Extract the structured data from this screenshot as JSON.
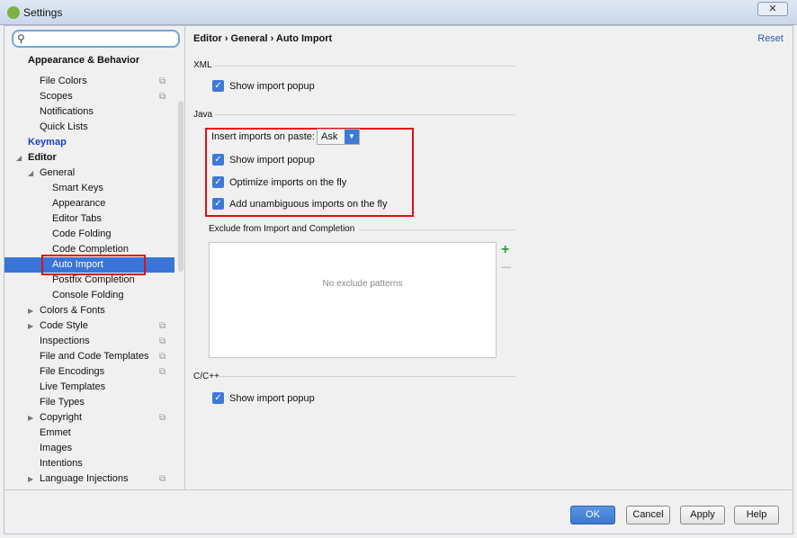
{
  "window": {
    "title": "Settings",
    "close": "✕"
  },
  "search": {
    "placeholder": "",
    "icon": "search-icon"
  },
  "tree": [
    {
      "label": "Appearance & Behavior",
      "level": 0,
      "bold": true
    },
    {
      "label": "File Colors",
      "level": 1,
      "copy": true
    },
    {
      "label": "Scopes",
      "level": 1,
      "copy": true
    },
    {
      "label": "Notifications",
      "level": 1
    },
    {
      "label": "Quick Lists",
      "level": 1
    },
    {
      "label": "Keymap",
      "level": 0,
      "bold": true,
      "link": true
    },
    {
      "label": "Editor",
      "level": 0,
      "bold": true,
      "expanded": true
    },
    {
      "label": "General",
      "level": 1,
      "expanded": true
    },
    {
      "label": "Smart Keys",
      "level": 2
    },
    {
      "label": "Appearance",
      "level": 2
    },
    {
      "label": "Editor Tabs",
      "level": 2
    },
    {
      "label": "Code Folding",
      "level": 2
    },
    {
      "label": "Code Completion",
      "level": 2
    },
    {
      "label": "Auto Import",
      "level": 2,
      "selected": true
    },
    {
      "label": "Postfix Completion",
      "level": 2
    },
    {
      "label": "Console Folding",
      "level": 2
    },
    {
      "label": "Colors & Fonts",
      "level": 1,
      "collapsed": true
    },
    {
      "label": "Code Style",
      "level": 1,
      "collapsed": true,
      "copy": true
    },
    {
      "label": "Inspections",
      "level": 1,
      "copy": true
    },
    {
      "label": "File and Code Templates",
      "level": 1,
      "copy": true
    },
    {
      "label": "File Encodings",
      "level": 1,
      "copy": true
    },
    {
      "label": "Live Templates",
      "level": 1
    },
    {
      "label": "File Types",
      "level": 1
    },
    {
      "label": "Copyright",
      "level": 1,
      "collapsed": true,
      "copy": true
    },
    {
      "label": "Emmet",
      "level": 1
    },
    {
      "label": "Images",
      "level": 1
    },
    {
      "label": "Intentions",
      "level": 1
    },
    {
      "label": "Language Injections",
      "level": 1,
      "collapsed": true,
      "copy": true
    }
  ],
  "main": {
    "breadcrumb": "Editor › General › Auto Import",
    "reset": "Reset",
    "xml": {
      "title": "XML",
      "show_popup": "Show import popup"
    },
    "java": {
      "title": "Java",
      "insert_label": "Insert imports on paste:",
      "insert_value": "Ask",
      "show_popup": "Show import popup",
      "optimize": "Optimize imports on the fly",
      "unambiguous": "Add unambiguous imports on the fly"
    },
    "exclude": {
      "title": "Exclude from Import and Completion",
      "empty": "No exclude patterns",
      "add": "+",
      "remove": "—"
    },
    "cpp": {
      "title": "C/C++",
      "show_popup": "Show import popup"
    }
  },
  "buttons": {
    "ok": "OK",
    "cancel": "Cancel",
    "apply": "Apply",
    "help": "Help"
  },
  "colors": {
    "accent": "#3875d7",
    "highlight": "#e01010"
  }
}
